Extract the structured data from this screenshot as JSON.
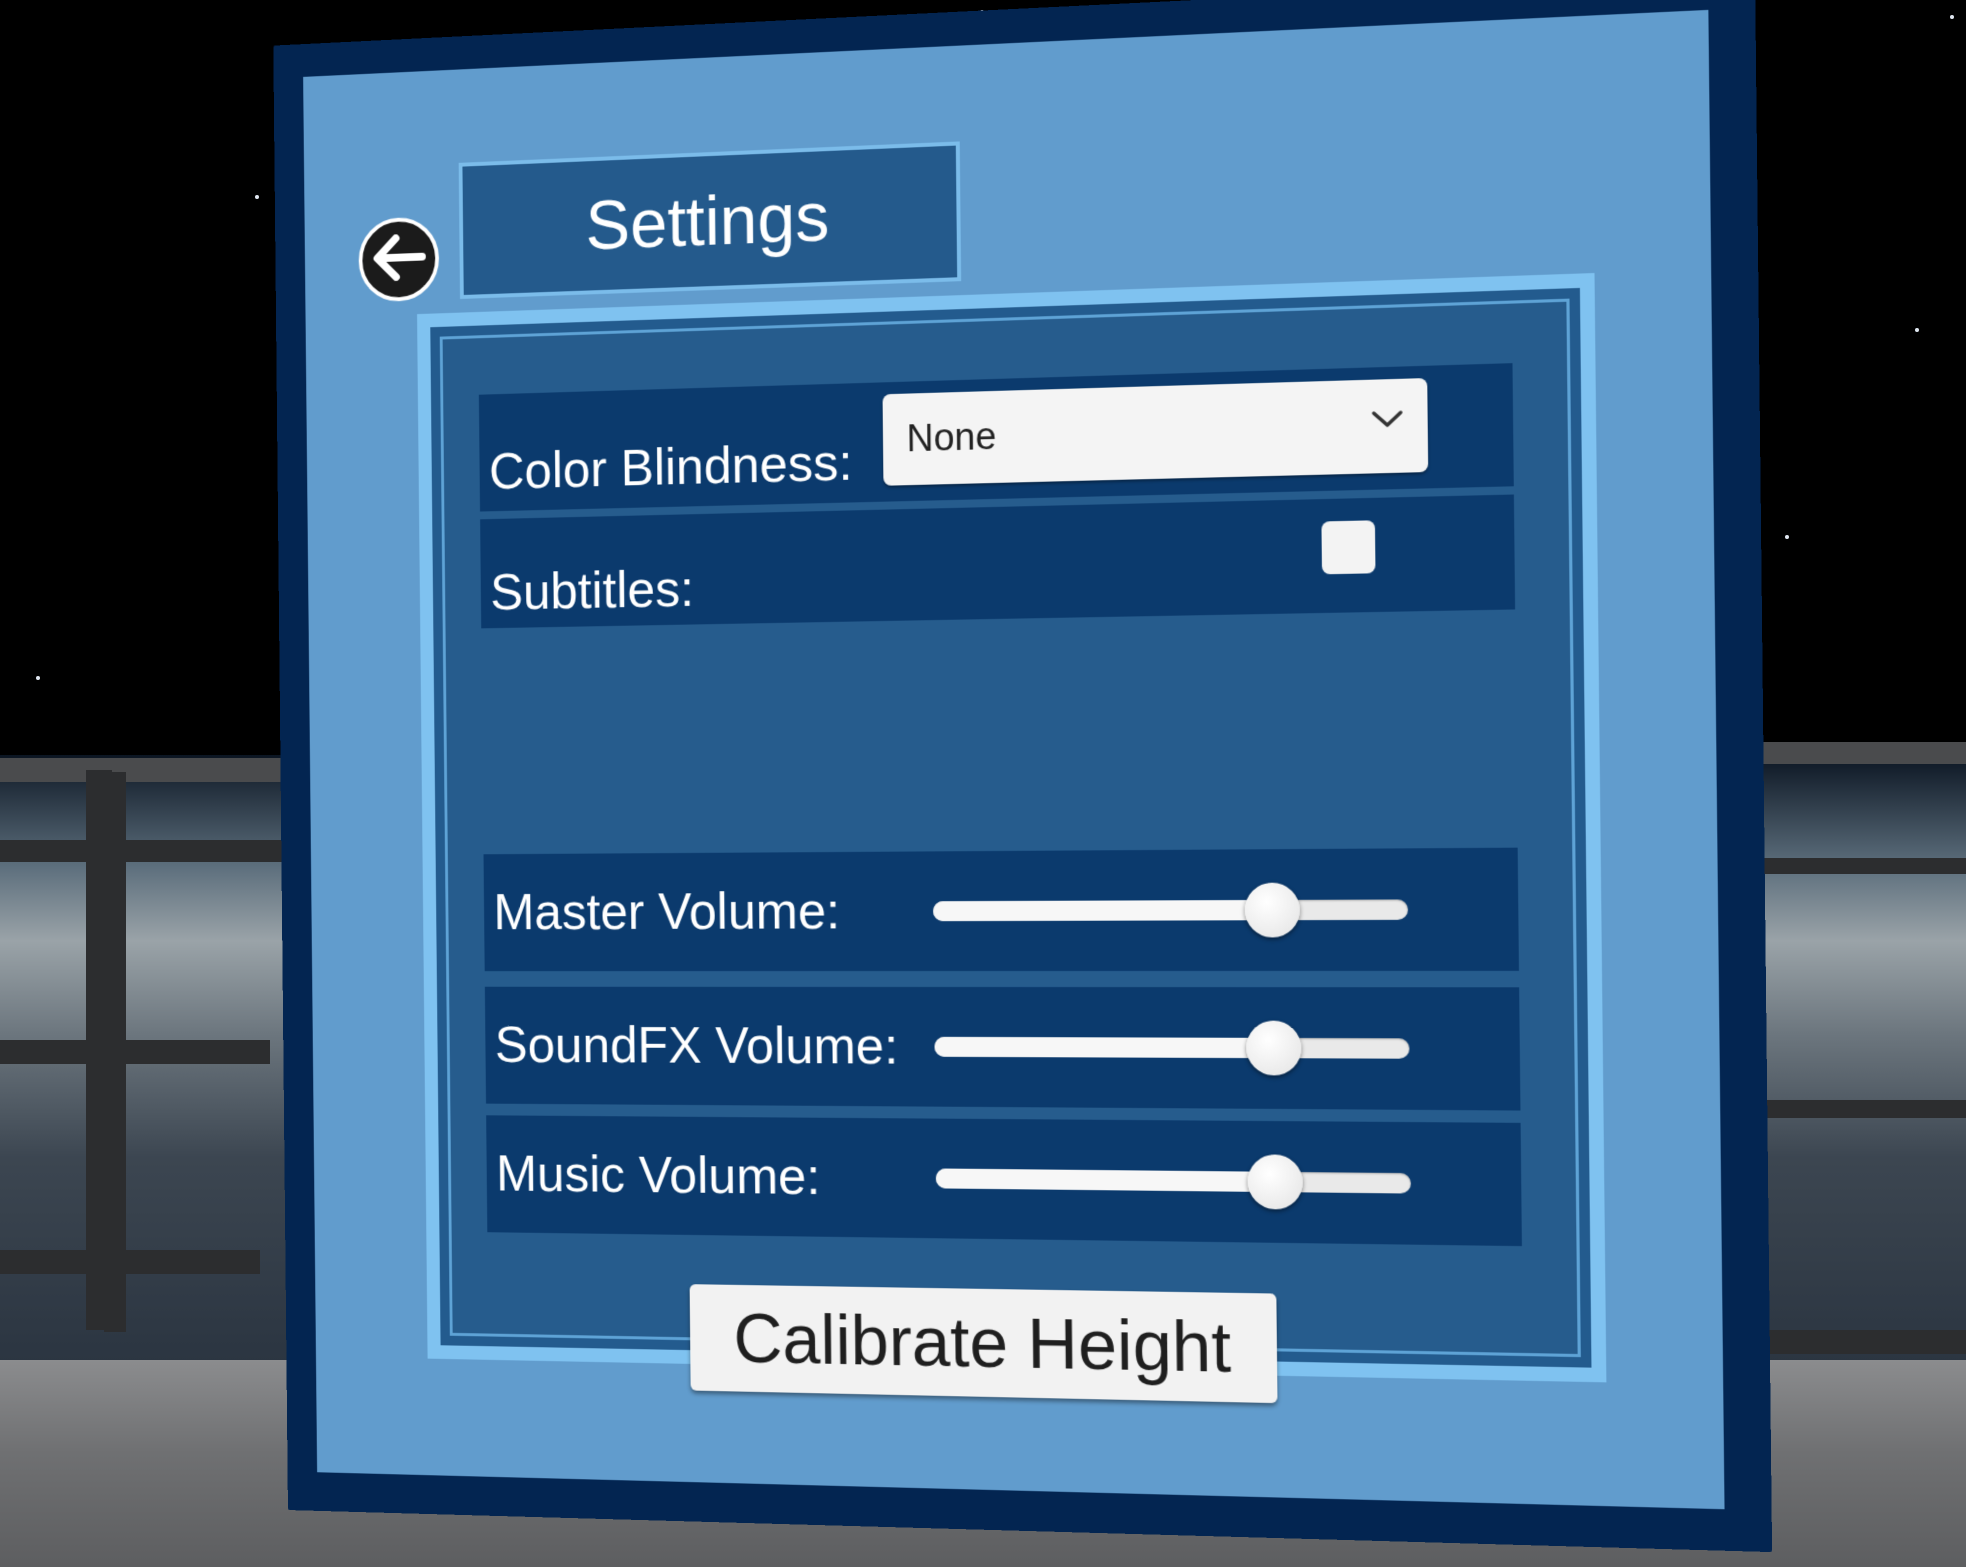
{
  "settings": {
    "title": "Settings",
    "back_icon": "arrow-left-icon",
    "color_blindness": {
      "label": "Color Blindness:",
      "selected": "None",
      "chevron_icon": "chevron-down-icon"
    },
    "subtitles": {
      "label": "Subtitles:",
      "checked": false
    },
    "volumes": [
      {
        "label": "Master Volume:",
        "value": 0.72
      },
      {
        "label": "SoundFX Volume:",
        "value": 0.72
      },
      {
        "label": "Music Volume:",
        "value": 0.72
      }
    ],
    "calibrate_label": "Calibrate Height"
  },
  "colors": {
    "panel_border": "#032551",
    "panel_fill": "#68a6d6",
    "row_fill": "#0b3a6d",
    "frame_accent": "#7fc2f0"
  }
}
